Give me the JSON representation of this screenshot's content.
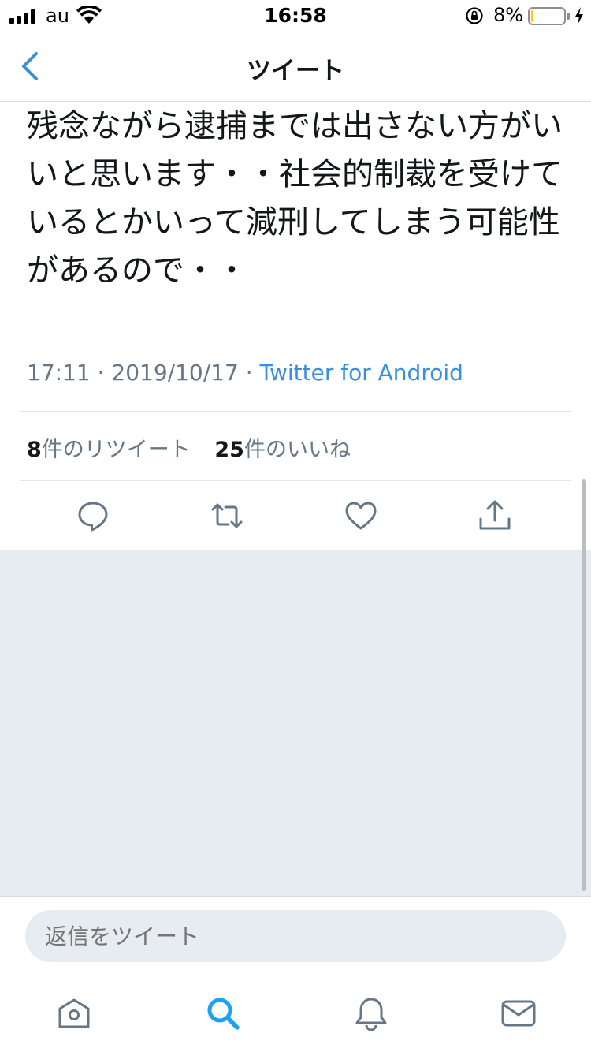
{
  "status_bar": {
    "carrier": "au",
    "time": "16:58",
    "battery_percent": "8%",
    "battery_level": 0.08,
    "battery_color": "#ffcc00"
  },
  "nav": {
    "title": "ツイート",
    "back_icon": "chevron-left-icon"
  },
  "tweet": {
    "text": "残念ながら逮捕までは出さない方がいいと思います・・社会的制裁を受けているとかいって減刑してしまう可能性があるので・・",
    "time": "17:11",
    "date": "2019/10/17",
    "separator": " · ",
    "source": "Twitter for Android"
  },
  "stats": {
    "retweets_count": "8",
    "retweets_label": "件のリツイート",
    "likes_count": "25",
    "likes_label": "件のいいね"
  },
  "actions": [
    "reply-icon",
    "retweet-icon",
    "like-icon",
    "share-icon"
  ],
  "reply": {
    "placeholder": "返信をツイート"
  },
  "tabs": [
    "home-icon",
    "search-icon",
    "notifications-icon",
    "messages-icon"
  ],
  "colors": {
    "accent": "#1da1f2",
    "link": "#3a8fdc",
    "muted": "#657786",
    "background_gray": "#e6ecf0"
  }
}
